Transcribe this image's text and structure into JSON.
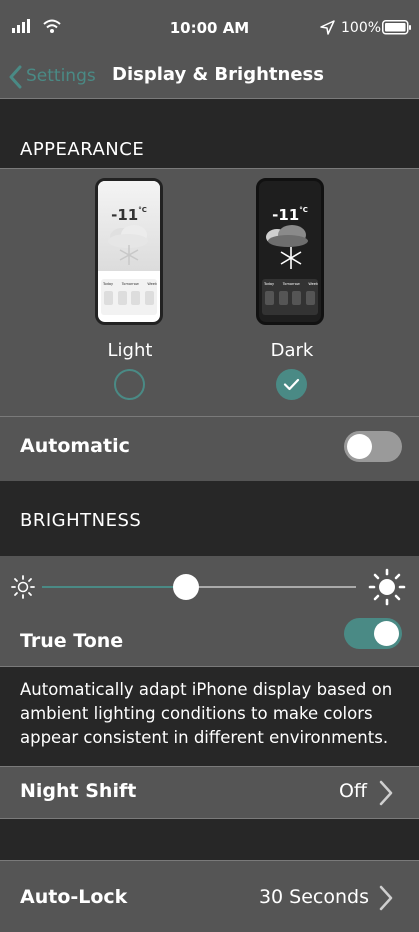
{
  "status": {
    "time": "10:00 AM",
    "battery": "100%"
  },
  "nav": {
    "back_label": "Settings",
    "title": "Display & Brightness"
  },
  "appearance": {
    "header": "APPEARANCE",
    "options": [
      {
        "label": "Light",
        "selected": false,
        "preview": {
          "temp": "-11",
          "unit": "°C",
          "tabs": [
            "Today",
            "Tomorrow",
            "Week"
          ]
        }
      },
      {
        "label": "Dark",
        "selected": true,
        "preview": {
          "temp": "-11",
          "unit": "°C",
          "tabs": [
            "Today",
            "Tomorrow",
            "Week"
          ]
        }
      }
    ],
    "automatic_label": "Automatic",
    "automatic_on": false
  },
  "brightness": {
    "header": "BRIGHTNESS",
    "level": 0.46,
    "true_tone_label": "True Tone",
    "true_tone_on": true,
    "description": "Automatically adapt iPhone display based on ambient lighting conditions to make colors appear consistent in different environments."
  },
  "night_shift": {
    "label": "Night Shift",
    "value": "Off"
  },
  "auto_lock": {
    "label": "Auto-Lock",
    "value": "30 Seconds"
  },
  "colors": {
    "accent": "#4a8a85",
    "group_bg": "#555555",
    "page_bg": "#272727",
    "toggle_off": "#9a9a9a"
  }
}
